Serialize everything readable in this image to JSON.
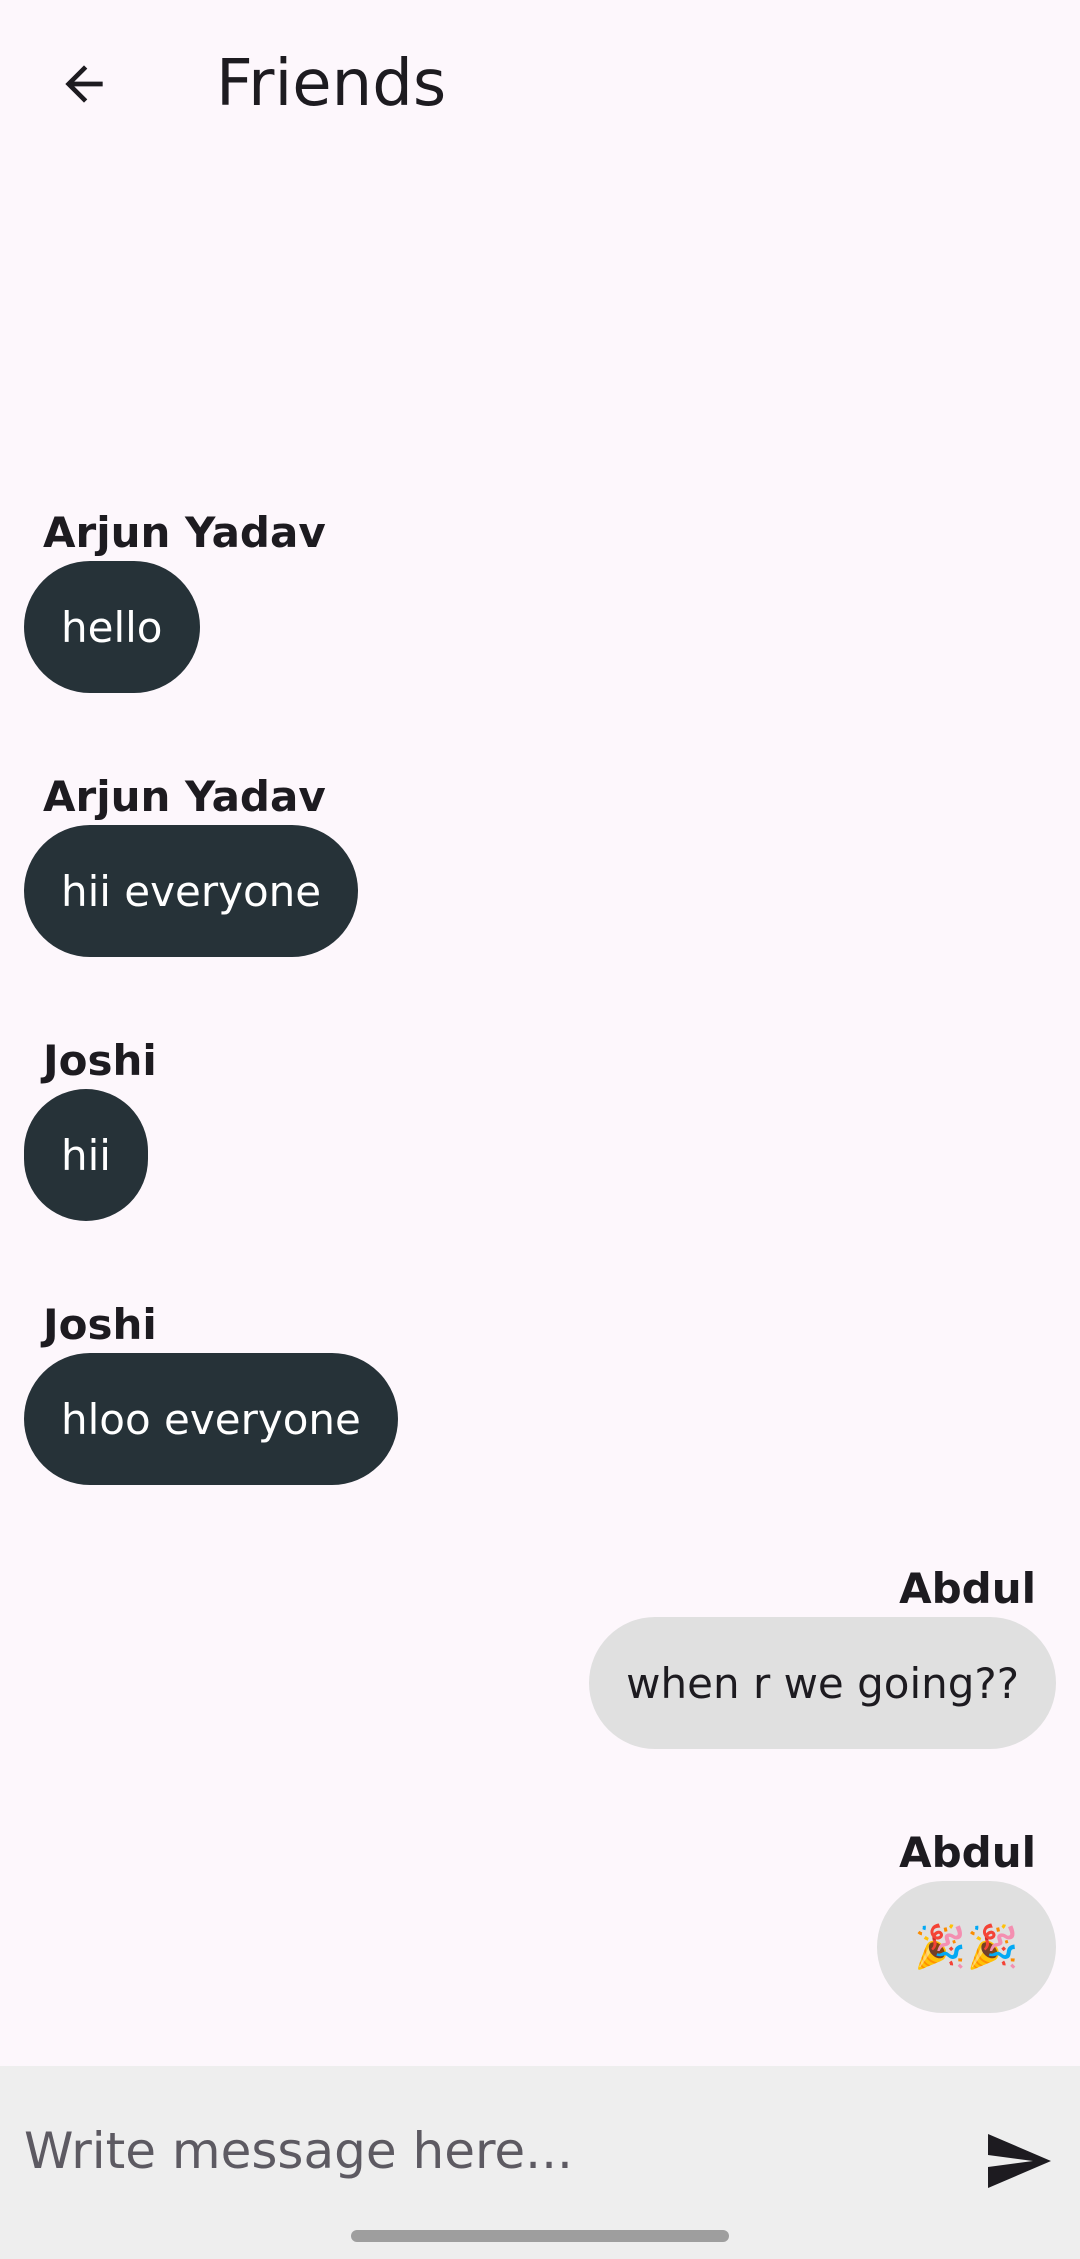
{
  "header": {
    "title": "Friends",
    "back_icon": "arrow-back-icon"
  },
  "messages": [
    {
      "sender": "Arjun Yadav",
      "text": "hello",
      "side": "left"
    },
    {
      "sender": "Arjun Yadav",
      "text": "hii everyone",
      "side": "left"
    },
    {
      "sender": "Joshi",
      "text": "hii",
      "side": "left"
    },
    {
      "sender": "Joshi",
      "text": "hloo everyone",
      "side": "left"
    },
    {
      "sender": "Abdul",
      "text": "when r we going??",
      "side": "right"
    },
    {
      "sender": "Abdul",
      "text": "🎉🎉",
      "side": "right"
    }
  ],
  "composer": {
    "placeholder": "Write message here...",
    "value": "",
    "send_icon": "send-icon"
  },
  "colors": {
    "background": "#fdf7fc",
    "incoming_bubble": "#263238",
    "outgoing_bubble": "#e0e0e0",
    "composer_bg": "#eeeeee"
  }
}
